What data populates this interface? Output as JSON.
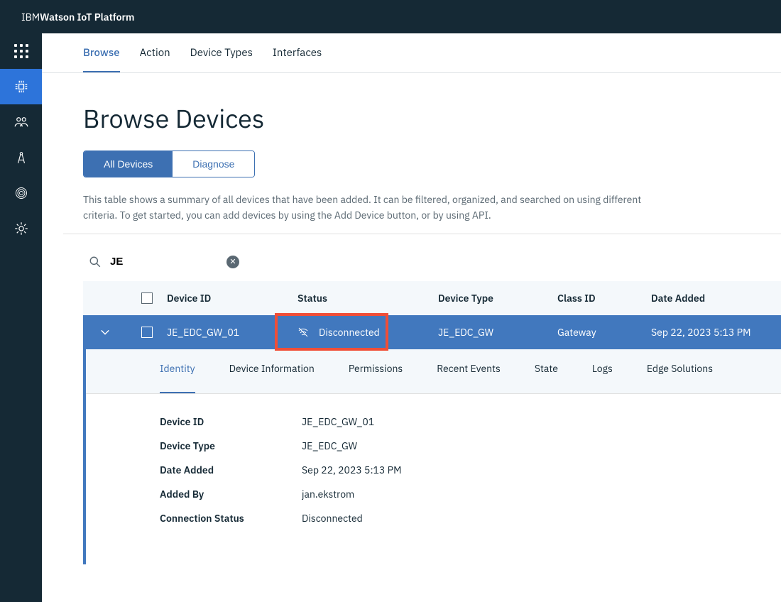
{
  "brand": {
    "light": "IBM ",
    "bold": "Watson IoT Platform"
  },
  "topTabs": [
    {
      "label": "Browse",
      "active": true
    },
    {
      "label": "Action"
    },
    {
      "label": "Device Types"
    },
    {
      "label": "Interfaces"
    }
  ],
  "page": {
    "title": "Browse Devices",
    "segments": [
      {
        "label": "All Devices",
        "selected": true
      },
      {
        "label": "Diagnose"
      }
    ],
    "description": "This table shows a summary of all devices that have been added. It can be filtered, organized, and searched on using different criteria. To get started, you can add devices by using the Add Device button, or by using API."
  },
  "search": {
    "value": "JE"
  },
  "table": {
    "headers": {
      "id": "Device ID",
      "status": "Status",
      "type": "Device Type",
      "class": "Class ID",
      "date": "Date Added"
    },
    "row": {
      "id": "JE_EDC_GW_01",
      "status": "Disconnected",
      "type": "JE_EDC_GW",
      "class": "Gateway",
      "date": "Sep 22, 2023 5:13 PM"
    }
  },
  "detailTabs": [
    {
      "label": "Identity",
      "active": true
    },
    {
      "label": "Device Information"
    },
    {
      "label": "Permissions"
    },
    {
      "label": "Recent Events"
    },
    {
      "label": "State"
    },
    {
      "label": "Logs"
    },
    {
      "label": "Edge Solutions"
    }
  ],
  "identity": {
    "device_id": {
      "k": "Device ID",
      "v": "JE_EDC_GW_01"
    },
    "device_type": {
      "k": "Device Type",
      "v": "JE_EDC_GW"
    },
    "date_added": {
      "k": "Date Added",
      "v": "Sep 22, 2023 5:13 PM"
    },
    "added_by": {
      "k": "Added By",
      "v": "jan.ekstrom"
    },
    "conn_status": {
      "k": "Connection Status",
      "v": "Disconnected"
    }
  }
}
